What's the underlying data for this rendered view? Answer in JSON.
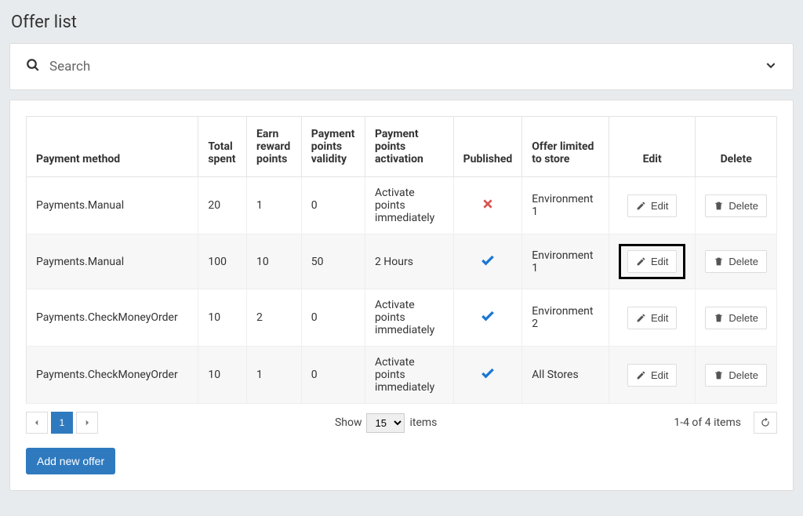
{
  "title": "Offer list",
  "search": {
    "placeholder": "Search"
  },
  "columns": {
    "payment_method": "Payment method",
    "total_spent": "Total spent",
    "earn_reward_points": "Earn reward points",
    "payment_points_validity": "Payment points validity",
    "payment_points_activation": "Payment points activation",
    "published": "Published",
    "offer_limited": "Offer limited to store",
    "edit": "Edit",
    "delete": "Delete"
  },
  "rows": [
    {
      "payment_method": "Payments.Manual",
      "total_spent": "20",
      "earn_reward_points": "1",
      "payment_points_validity": "0",
      "payment_points_activation": "Activate points immediately",
      "published": false,
      "offer_limited": "Environment 1",
      "highlight_edit": false
    },
    {
      "payment_method": "Payments.Manual",
      "total_spent": "100",
      "earn_reward_points": "10",
      "payment_points_validity": "50",
      "payment_points_activation": "2 Hours",
      "published": true,
      "offer_limited": "Environment 1",
      "highlight_edit": true
    },
    {
      "payment_method": "Payments.CheckMoneyOrder",
      "total_spent": "10",
      "earn_reward_points": "2",
      "payment_points_validity": "0",
      "payment_points_activation": "Activate points immediately",
      "published": true,
      "offer_limited": "Environment 2",
      "highlight_edit": false
    },
    {
      "payment_method": "Payments.CheckMoneyOrder",
      "total_spent": "10",
      "earn_reward_points": "1",
      "payment_points_validity": "0",
      "payment_points_activation": "Activate points immediately",
      "published": true,
      "offer_limited": "All Stores",
      "highlight_edit": false
    }
  ],
  "buttons": {
    "edit": "Edit",
    "delete": "Delete",
    "add_new": "Add new offer"
  },
  "pager": {
    "current": "1",
    "show_prefix": "Show",
    "show_suffix": "items",
    "page_size": "15",
    "summary": "1-4 of 4 items"
  }
}
